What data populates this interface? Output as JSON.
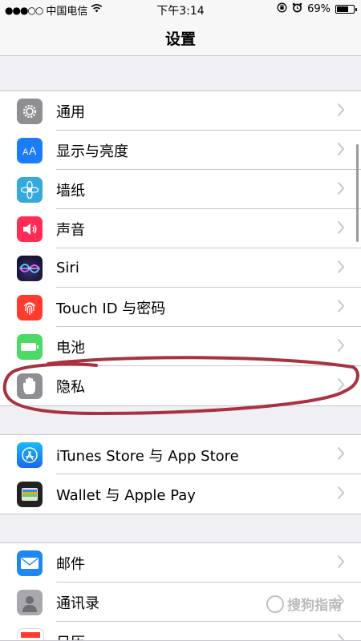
{
  "status_bar": {
    "signal": "●●●○○",
    "carrier": "中国电信",
    "time": "下午3:14",
    "battery": "69%",
    "battery_level": 0.69,
    "wifi_icon": "wifi-icon",
    "orientation_lock_icon": "orientation-lock-icon",
    "alarm_icon": "alarm-icon"
  },
  "nav": {
    "title": "设置"
  },
  "groups": [
    {
      "items": [
        {
          "label": "通用",
          "icon": "gear-icon",
          "color": "#8e8e93"
        },
        {
          "label": "显示与亮度",
          "icon": "text-size-icon",
          "color": "#1b7cf7"
        },
        {
          "label": "墙纸",
          "icon": "flower-icon",
          "color": "#34aadc"
        },
        {
          "label": "声音",
          "icon": "speaker-icon",
          "color": "#ff2d55"
        },
        {
          "label": "Siri",
          "icon": "siri-icon",
          "color": "#1c1c3a"
        },
        {
          "label": "Touch ID 与密码",
          "icon": "fingerprint-icon",
          "color": "#ff3b30"
        },
        {
          "label": "电池",
          "icon": "battery-icon",
          "color": "#4cd964"
        },
        {
          "label": "隐私",
          "icon": "hand-icon",
          "color": "#8e8e93"
        }
      ]
    },
    {
      "items": [
        {
          "label": "iTunes Store 与 App Store",
          "icon": "app-store-icon",
          "color": "#1e88f0"
        },
        {
          "label": "Wallet 与 Apple Pay",
          "icon": "wallet-icon",
          "color": "#222222"
        }
      ]
    },
    {
      "items": [
        {
          "label": "邮件",
          "icon": "mail-icon",
          "color": "#1e88f0"
        },
        {
          "label": "通讯录",
          "icon": "contacts-icon",
          "color": "#a8a8ad"
        },
        {
          "label": "日历",
          "icon": "calendar-icon",
          "color": "#ffffff"
        }
      ]
    }
  ],
  "watermark": {
    "text": "搜狗指南"
  },
  "annotation": {
    "color": "#a8323f"
  }
}
